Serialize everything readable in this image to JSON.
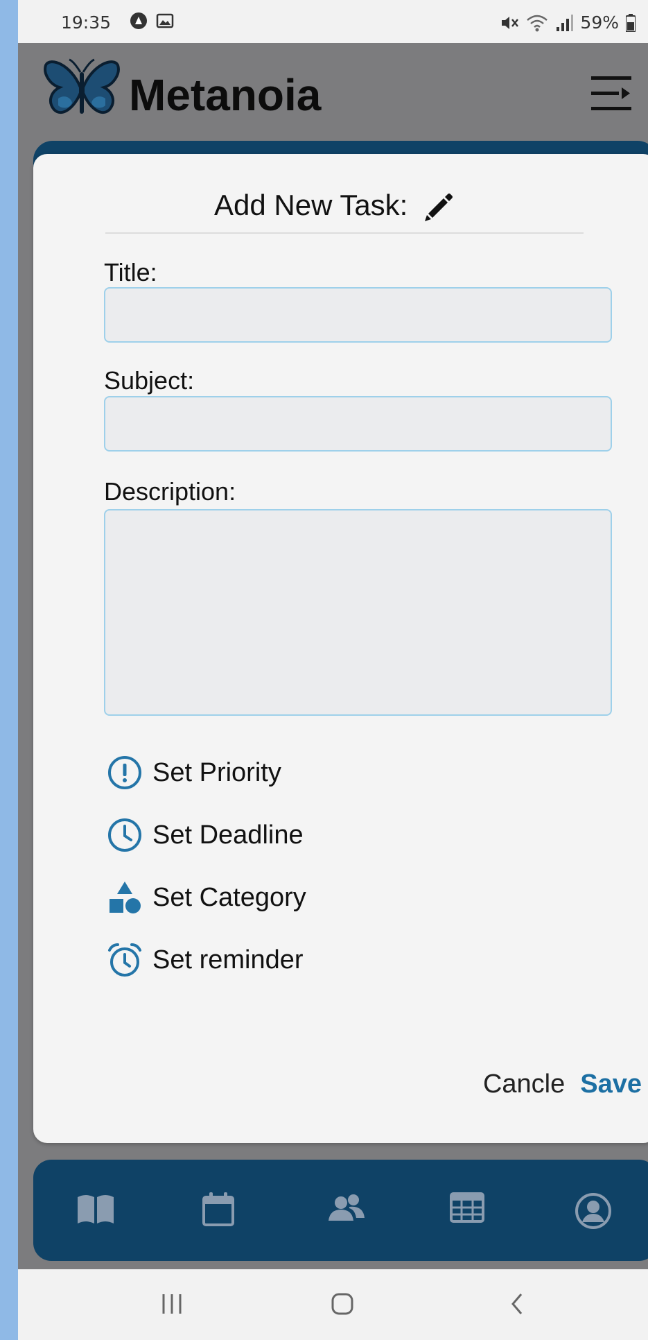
{
  "status_bar": {
    "time": "19:35",
    "battery": "59%",
    "icons": [
      "app-notification-icon",
      "gallery-notification-icon",
      "mute-icon",
      "wifi-icon",
      "signal-icon",
      "battery-icon"
    ]
  },
  "header": {
    "app_name": "Metanoia",
    "logo": "butterfly-logo",
    "menu_icon": "menu-icon"
  },
  "modal": {
    "title": "Add New Task:",
    "title_icon": "pencil-icon",
    "fields": {
      "title": {
        "label": "Title:",
        "value": "",
        "placeholder": ""
      },
      "subject": {
        "label": "Subject:",
        "value": "",
        "placeholder": ""
      },
      "description": {
        "label": "Description:",
        "value": "",
        "placeholder": ""
      }
    },
    "options": [
      {
        "label": "Set Priority",
        "icon": "exclamation-circle-icon"
      },
      {
        "label": "Set Deadline",
        "icon": "clock-icon"
      },
      {
        "label": "Set Category",
        "icon": "shapes-icon"
      },
      {
        "label": "Set reminder",
        "icon": "alarm-clock-icon"
      }
    ],
    "actions": {
      "cancel": "Cancle",
      "save": "Save"
    }
  },
  "bottom_nav": {
    "items": [
      "book-icon",
      "calendar-icon",
      "people-icon",
      "table-icon",
      "user-circle-icon"
    ]
  },
  "system_nav": {
    "buttons": [
      "recent-apps-icon",
      "home-icon",
      "back-icon"
    ]
  },
  "colors": {
    "primary": "#0f4266",
    "accent": "#1c6fa3",
    "icon_blue": "#2475a8",
    "overlay": "#7c7c7e",
    "field_bg": "#ebecee",
    "field_border": "#9ed0ea"
  }
}
